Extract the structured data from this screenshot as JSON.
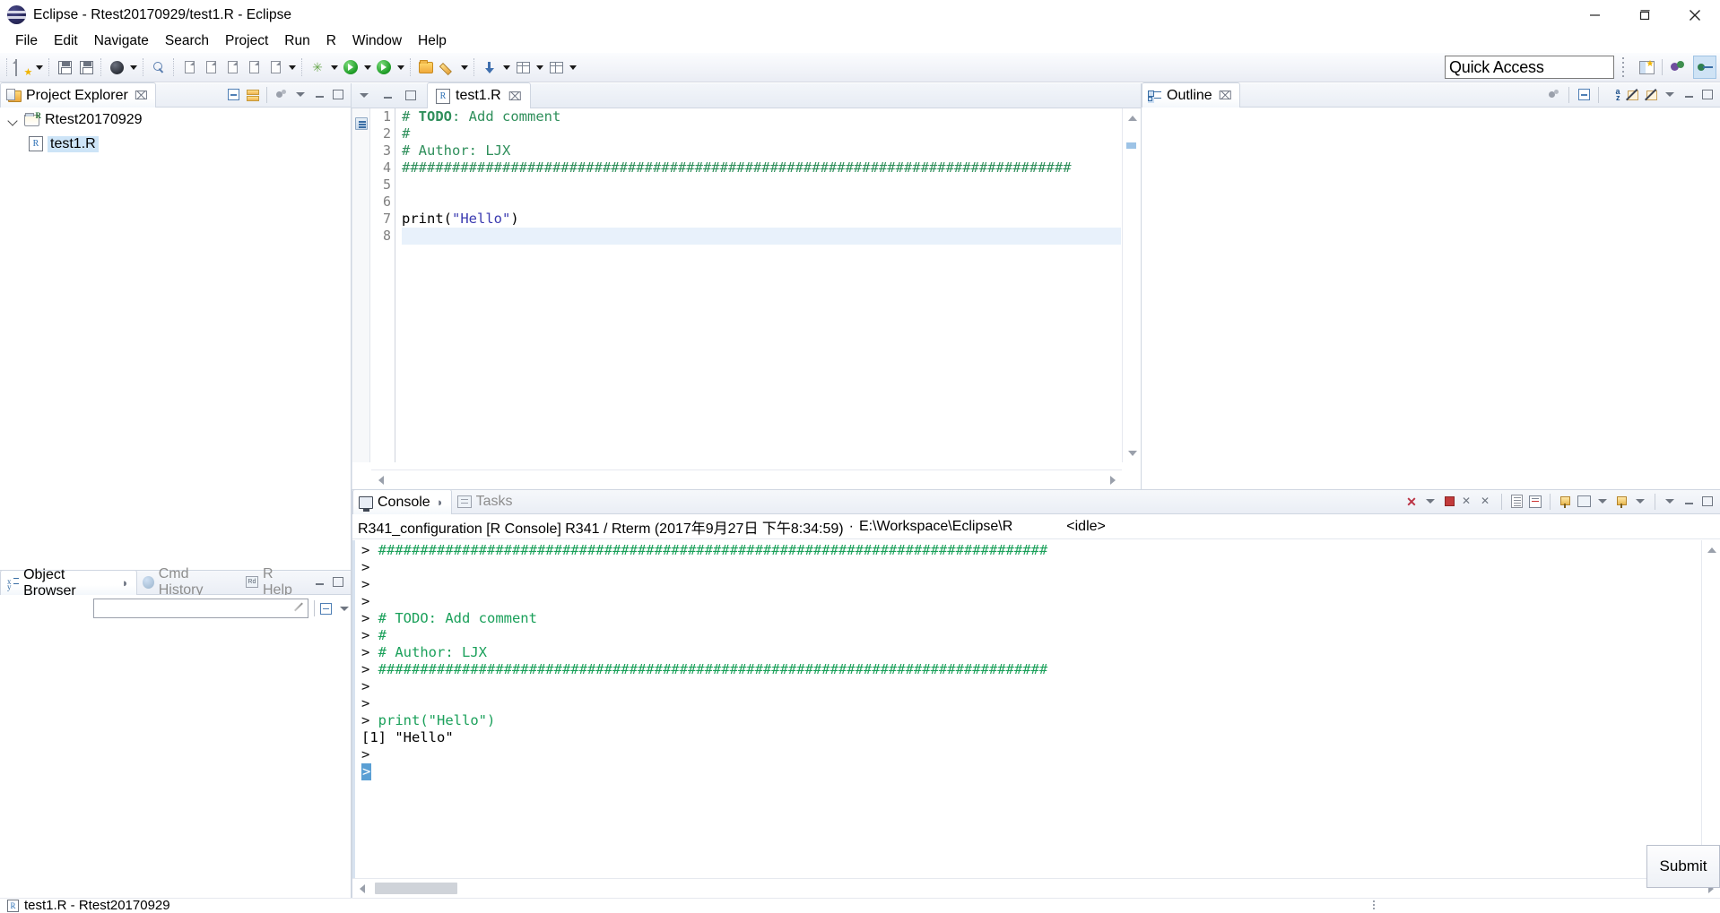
{
  "window": {
    "title": "Eclipse - Rtest20170929/test1.R - Eclipse",
    "icon": "eclipse-logo-icon",
    "controls": {
      "minimize": "minimize-icon",
      "maximize": "maximize-icon",
      "close": "close-icon"
    }
  },
  "menubar": {
    "items": [
      "File",
      "Edit",
      "Navigate",
      "Search",
      "Project",
      "Run",
      "R",
      "Window",
      "Help"
    ]
  },
  "toolbar": {
    "quick_access_placeholder": "Quick Access",
    "quick_access_value": "",
    "groups": [
      {
        "name": "new-group",
        "buttons": [
          "new-wizard-icon"
        ],
        "arrow": true
      },
      {
        "name": "save-group",
        "buttons": [
          "save-icon",
          "save-all-icon"
        ]
      },
      {
        "name": "debug-group",
        "buttons": [
          "debug-icon"
        ],
        "arrow": true
      },
      {
        "name": "search-group",
        "buttons": [
          "search-pen-icon"
        ]
      },
      {
        "name": "r-group",
        "buttons": [
          "r-script-icon",
          "r-data-icon",
          "r-console-icon",
          "r-source-icon",
          "r-doc-icon"
        ],
        "arrow": true
      },
      {
        "name": "wizard-group",
        "buttons": [
          "magic-wand-icon"
        ],
        "arrow": true
      },
      {
        "name": "run-group",
        "buttons": [
          "run-icon"
        ],
        "arrow": true
      },
      {
        "name": "run2-group",
        "buttons": [
          "run-external-icon"
        ],
        "arrow": true
      },
      {
        "name": "folder-group",
        "buttons": [
          "open-folder-icon",
          "edit-pencil-icon"
        ],
        "arrow": true
      },
      {
        "name": "download-group",
        "buttons": [
          "download-icon"
        ],
        "arrow": true
      },
      {
        "name": "table-group",
        "buttons": [
          "table-icon"
        ],
        "arrow": true
      }
    ],
    "perspective": {
      "open_perspective": "open-perspective-icon",
      "items": [
        "debug-perspective-icon",
        "r-perspective-icon"
      ]
    }
  },
  "project_explorer": {
    "tab_label": "Project Explorer",
    "tab_icon": "project-explorer-icon",
    "close_glyph": "⌧",
    "tools": [
      "collapse-all-icon",
      "link-with-editor-icon",
      "view-menu-icon"
    ],
    "min_max": [
      "minimize-icon",
      "maximize-icon"
    ],
    "tree": [
      {
        "label": "Rtest20170929",
        "icon": "r-project-folder-icon",
        "expanded": true,
        "selected": false,
        "level": 0
      },
      {
        "label": "test1.R",
        "icon": "r-file-icon",
        "expanded": false,
        "selected": true,
        "level": 1
      }
    ]
  },
  "object_browser": {
    "tabs": [
      {
        "label": "Object Browser",
        "icon": "object-browser-icon",
        "active": true,
        "closable": true
      },
      {
        "label": "Cmd History",
        "icon": "cmd-history-icon",
        "active": false,
        "closable": false
      },
      {
        "label": "R Help",
        "icon": "r-help-icon",
        "active": false,
        "closable": false
      }
    ],
    "search_value": "",
    "search_placeholder": "",
    "tools": [
      "collapse-all-icon",
      "view-menu-icon"
    ],
    "min_max": [
      "minimize-icon",
      "maximize-icon"
    ]
  },
  "editor": {
    "tab": {
      "label": "test1.R",
      "icon": "r-file-icon",
      "close_glyph": "⌧"
    },
    "min_max": [
      "minimize-icon",
      "maximize-icon"
    ],
    "left_icons": [
      "view-menu-icon",
      "minimize-icon",
      "maximize-icon"
    ],
    "current_line": 8,
    "lines": [
      {
        "n": 1,
        "tokens": [
          {
            "t": "# ",
            "c": "cm"
          },
          {
            "t": "TODO",
            "c": "cm-b"
          },
          {
            "t": ": Add comment",
            "c": "cm"
          }
        ]
      },
      {
        "n": 2,
        "tokens": [
          {
            "t": "#",
            "c": "cm"
          }
        ]
      },
      {
        "n": 3,
        "tokens": [
          {
            "t": "# Author: LJX",
            "c": "cm"
          }
        ]
      },
      {
        "n": 4,
        "tokens": [
          {
            "t": "################################################################################",
            "c": "cm"
          }
        ]
      },
      {
        "n": 5,
        "tokens": []
      },
      {
        "n": 6,
        "tokens": []
      },
      {
        "n": 7,
        "tokens": [
          {
            "t": "print(",
            "c": ""
          },
          {
            "t": "\"Hello\"",
            "c": "str"
          },
          {
            "t": ")",
            "c": ""
          }
        ]
      },
      {
        "n": 8,
        "tokens": []
      }
    ]
  },
  "outline": {
    "tab_label": "Outline",
    "tab_icon": "outline-icon",
    "close_glyph": "⌧",
    "tools": [
      "view-menu-gear-icon",
      "collapse-all-icon",
      "sort-az-icon",
      "hide-fields-icon",
      "hide-static-icon"
    ],
    "min_max": [
      "view-menu-icon",
      "minimize-icon",
      "maximize-icon"
    ],
    "content": []
  },
  "console": {
    "tabs": [
      {
        "label": "Console",
        "icon": "console-icon",
        "active": true,
        "closable": true
      },
      {
        "label": "Tasks",
        "icon": "tasks-icon",
        "active": false,
        "closable": false
      }
    ],
    "tools": [
      "terminate-icon",
      "terminate-menu-icon",
      "stop-icon",
      "remove-launch-icon",
      "remove-all-icon",
      "clear-console-icon",
      "scroll-lock-icon",
      "pin-console-icon",
      "display-selected-icon",
      "display-menu-icon",
      "open-console-icon",
      "open-console-menu-icon"
    ],
    "min_max": [
      "view-menu-icon",
      "minimize-icon",
      "maximize-icon"
    ],
    "header": {
      "config": "R341_configuration [R Console] R341 / Rterm (2017年9月27日 下午8:34:59)",
      "separator": "·",
      "workspace": "E:\\Workspace\\Eclipse\\R",
      "state": "<idle>"
    },
    "output": [
      {
        "prompt": ">",
        "text": "################################################################################",
        "color": "green"
      },
      {
        "prompt": ">",
        "text": "",
        "color": "green"
      },
      {
        "prompt": ">",
        "text": "",
        "color": "green"
      },
      {
        "prompt": ">",
        "text": "",
        "color": "green"
      },
      {
        "prompt": ">",
        "text": "# TODO: Add comment",
        "color": "green"
      },
      {
        "prompt": ">",
        "text": "#",
        "color": "green"
      },
      {
        "prompt": ">",
        "text": "# Author: LJX",
        "color": "green"
      },
      {
        "prompt": ">",
        "text": "################################################################################",
        "color": "green"
      },
      {
        "prompt": ">",
        "text": "",
        "color": "green"
      },
      {
        "prompt": ">",
        "text": "",
        "color": "green"
      },
      {
        "prompt": ">",
        "text": "print(\"Hello\")",
        "color": "green"
      },
      {
        "prompt": "",
        "text": "[1] \"Hello\"",
        "color": "black"
      },
      {
        "prompt": ">",
        "text": "",
        "color": "green"
      },
      {
        "prompt": "cursor",
        "text": "",
        "color": "cursor"
      }
    ]
  },
  "submit_button": {
    "label": "Submit"
  },
  "statusbar": {
    "icon": "r-file-icon",
    "text": "test1.R - Rtest20170929"
  }
}
